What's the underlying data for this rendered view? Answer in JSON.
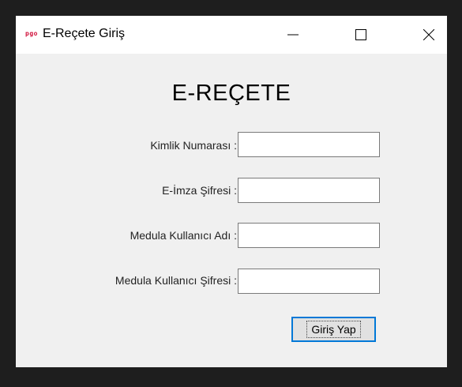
{
  "window": {
    "title": "E-Reçete Giriş",
    "icon_label": "pgo"
  },
  "form": {
    "heading": "E-REÇETE",
    "fields": [
      {
        "label": "Kimlik Numarası :",
        "value": ""
      },
      {
        "label": "E-İmza Şifresi :",
        "value": ""
      },
      {
        "label": "Medula Kullanıcı Adı :",
        "value": ""
      },
      {
        "label": "Medula Kullanıcı Şifresi :",
        "value": ""
      }
    ],
    "submit_label": "Giriş Yap"
  },
  "colors": {
    "accent": "#0078d7",
    "icon": "#d0103a",
    "window_bg": "#f0f0f0"
  }
}
